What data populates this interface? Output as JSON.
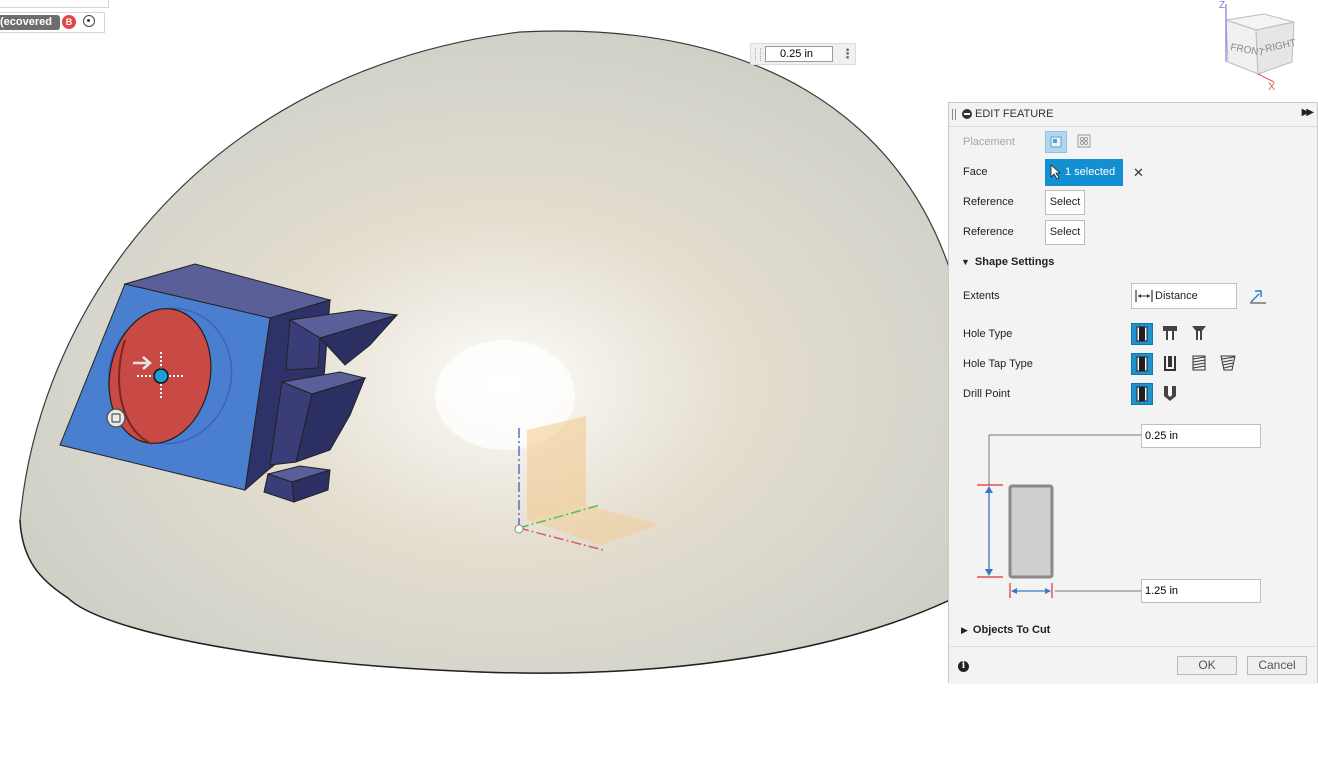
{
  "document": {
    "title_fragment": "ecovered)",
    "badge": "B"
  },
  "viewport": {
    "dimension_input_value": "0.25 in"
  },
  "viewcube": {
    "front_label": "FRONT",
    "right_label": "RIGHT",
    "axis_z": "Z",
    "axis_x": "X"
  },
  "panel": {
    "title": "EDIT FEATURE",
    "placement_label": "Placement",
    "face_label": "Face",
    "face_selection": "1 selected",
    "reference1_label": "Reference",
    "reference1_button": "Select",
    "reference2_label": "Reference",
    "reference2_button": "Select",
    "shape_settings_label": "Shape Settings",
    "extents_label": "Extents",
    "extents_value": "Distance",
    "hole_type_label": "Hole Type",
    "hole_tap_type_label": "Hole Tap Type",
    "drill_point_label": "Drill Point",
    "depth_value": "0.25 in",
    "diameter_value": "1.25 in",
    "objects_to_cut_label": "Objects To Cut",
    "ok_label": "OK",
    "cancel_label": "Cancel"
  }
}
